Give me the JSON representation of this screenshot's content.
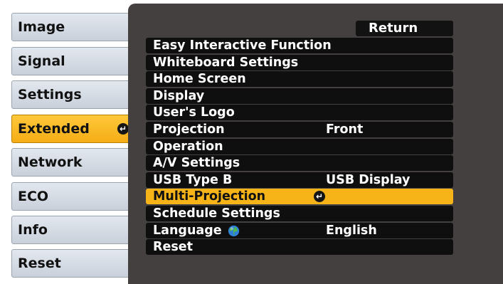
{
  "tabs": [
    {
      "label": "Image",
      "selected": false
    },
    {
      "label": "Signal",
      "selected": false
    },
    {
      "label": "Settings",
      "selected": false
    },
    {
      "label": "Extended",
      "selected": true
    },
    {
      "label": "Network",
      "selected": false
    },
    {
      "label": "ECO",
      "selected": false
    },
    {
      "label": "Info",
      "selected": false
    },
    {
      "label": "Reset",
      "selected": false
    }
  ],
  "panel": {
    "return_label": "Return",
    "rows": [
      {
        "label": "Easy Interactive Function",
        "value": ""
      },
      {
        "label": "Whiteboard Settings",
        "value": ""
      },
      {
        "label": "Home Screen",
        "value": ""
      },
      {
        "label": "Display",
        "value": ""
      },
      {
        "label": "User's Logo",
        "value": ""
      },
      {
        "label": "Projection",
        "value": "Front"
      },
      {
        "label": "Operation",
        "value": ""
      },
      {
        "label": "A/V Settings",
        "value": ""
      },
      {
        "label": "USB Type B",
        "value": "USB Display"
      },
      {
        "label": "Multi-Projection",
        "value": "",
        "selected": true
      },
      {
        "label": "Schedule Settings",
        "value": ""
      },
      {
        "label": "Language",
        "value": "English",
        "icon": "globe-icon"
      },
      {
        "label": "Reset",
        "value": ""
      }
    ]
  },
  "colors": {
    "accent": "#f7b418",
    "panel_bg": "#43403f",
    "row_bg": "#0f0f0f",
    "tab_bg": "#d6dce4"
  }
}
